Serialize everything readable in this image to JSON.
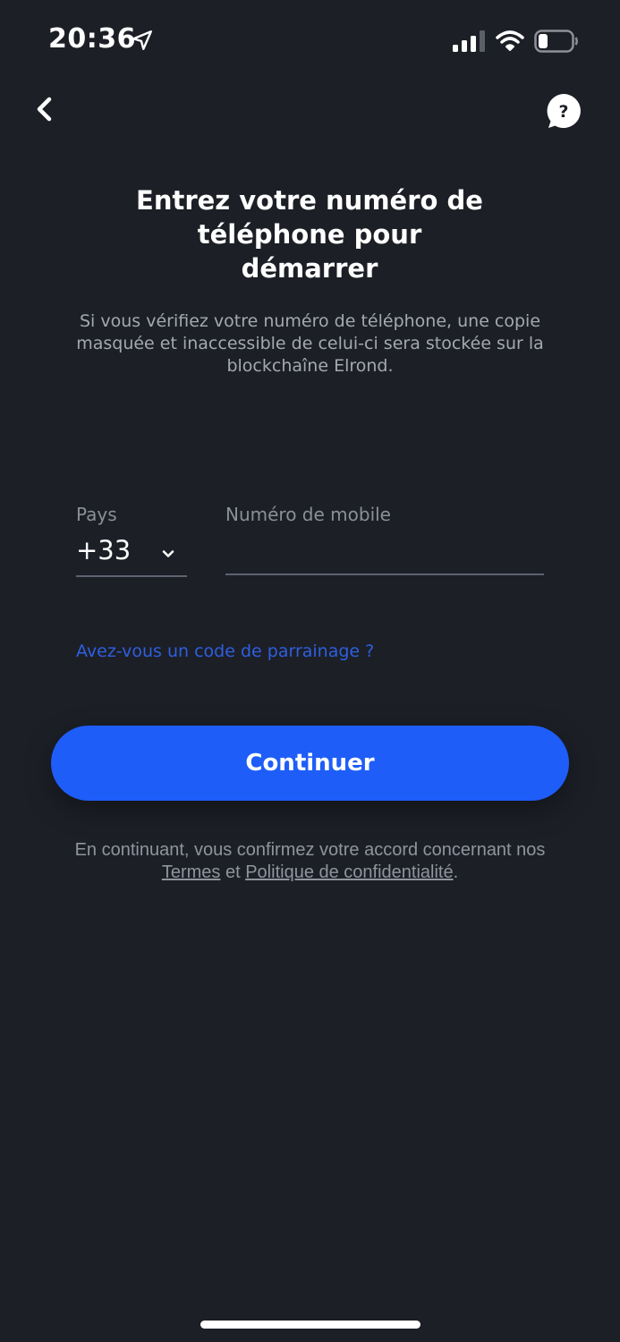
{
  "status_bar": {
    "time": "20:36",
    "icons": [
      "location-arrow-icon",
      "cellular-signal-icon",
      "wifi-icon",
      "battery-icon"
    ]
  },
  "header": {
    "back_icon": "chevron-left-icon",
    "help_icon": "question-bubble-icon"
  },
  "main": {
    "title_line1": "Entrez votre numéro de",
    "title_line2": "téléphone pour",
    "title_line3": "démarrer",
    "subtitle": "Si vous vérifiez votre numéro de téléphone, une copie masquée et inaccessible de celui-ci sera stockée sur la blockchaîne Elrond."
  },
  "form": {
    "country_label": "Pays",
    "country_code": "+33",
    "phone_label": "Numéro de mobile",
    "phone_value": "",
    "referral_link": "Avez-vous un code de parrainage ?"
  },
  "actions": {
    "continue_label": "Continuer"
  },
  "legal": {
    "prefix": "En continuant, vous confirmez votre accord concernant nos",
    "terms": "Termes",
    "conjunction": "et",
    "privacy": "Politique de confidentialité",
    "suffix": "."
  },
  "colors": {
    "background": "#1c1f26",
    "accent": "#1e5df8",
    "link": "#2f5fe0",
    "muted_text": "#a4a8b2"
  }
}
